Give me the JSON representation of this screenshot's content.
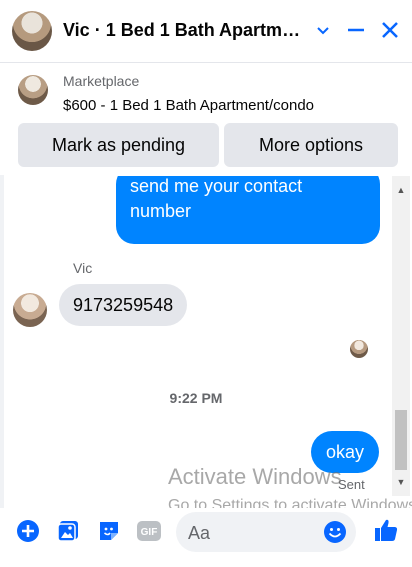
{
  "header": {
    "title": "Vic · 1 Bed 1 Bath Apartme..."
  },
  "listing": {
    "source": "Marketplace",
    "description": "$600 - 1 Bed 1 Bath Apartment/condo",
    "mark_pending_label": "Mark as pending",
    "more_options_label": "More options"
  },
  "messages": {
    "outgoing_1": "send me your contact number",
    "sender_name": "Vic",
    "incoming_1": "9173259548",
    "timestamp": "9:22 PM",
    "outgoing_2": "okay",
    "status": "Sent"
  },
  "watermark": {
    "line1": "Activate Windows",
    "line2": "Go to Settings to activate Windows."
  },
  "composer": {
    "placeholder": "Aa"
  },
  "colors": {
    "accent": "#0866ff",
    "outgoing_bubble": "#0084ff",
    "incoming_bubble": "#e4e6eb"
  }
}
